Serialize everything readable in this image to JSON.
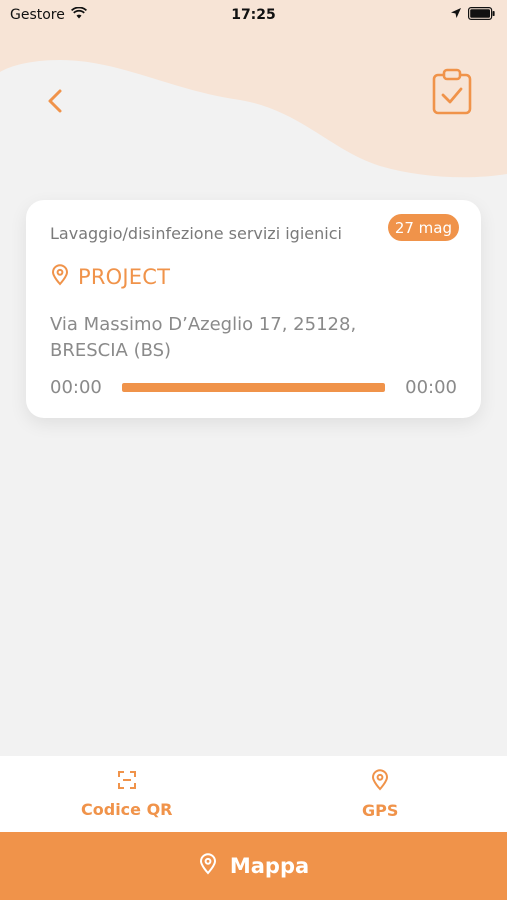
{
  "status_bar": {
    "carrier": "Gestore",
    "time": "17:25"
  },
  "header": {
    "back_icon": "chevron-left-icon",
    "clipboard_icon": "clipboard-check-icon"
  },
  "card": {
    "service": "Lavaggio/disinfezione servizi igienici",
    "date_badge": "27 mag",
    "project_name": "PROJECT",
    "address_line1": "Via Massimo D’Azeglio 17, 25128,",
    "address_line2": "BRESCIA (BS)",
    "start_time": "00:00",
    "end_time": "00:00",
    "progress": 1.0
  },
  "bottom_tabs": [
    {
      "label": "Codice QR",
      "icon": "qr-scan-icon"
    },
    {
      "label": "GPS",
      "icon": "location-pin-icon"
    }
  ],
  "map_button": {
    "label": "Mappa",
    "icon": "location-pin-icon"
  },
  "colors": {
    "accent": "#f0934a",
    "header_bg": "#f7e4d6",
    "background": "#f2f2f2"
  }
}
